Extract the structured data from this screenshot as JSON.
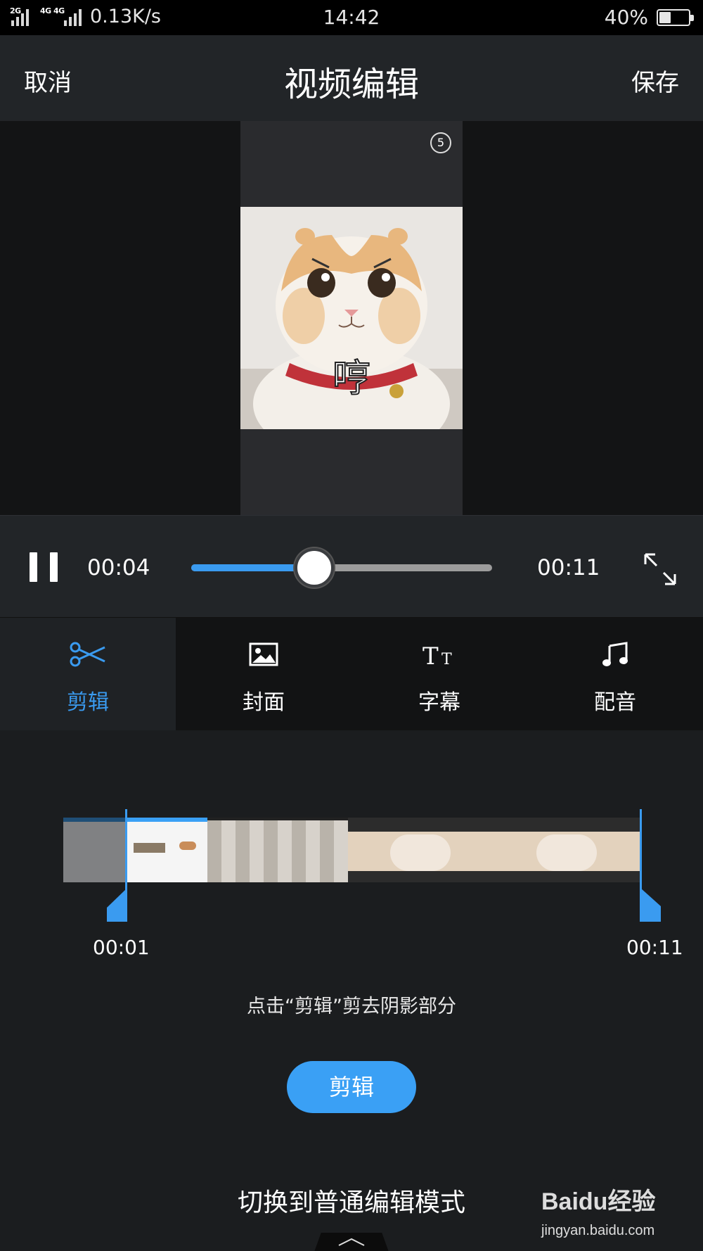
{
  "status_bar": {
    "net_speed": "0.13K/s",
    "time": "14:42",
    "battery_pct": "40%",
    "battery_level": 0.4,
    "signal_1_tag": "2G",
    "signal_2_tag": "4G 4G"
  },
  "header": {
    "cancel_label": "取消",
    "title": "视频编辑",
    "save_label": "保存"
  },
  "preview": {
    "page_counter": "5",
    "caption": "哼"
  },
  "playback": {
    "current_time": "00:04",
    "total_time": "00:11",
    "progress": 0.41
  },
  "tabs": [
    {
      "label": "剪辑",
      "icon": "scissors-icon",
      "active": true
    },
    {
      "label": "封面",
      "icon": "image-icon",
      "active": false
    },
    {
      "label": "字幕",
      "icon": "text-size-icon",
      "active": false
    },
    {
      "label": "配音",
      "icon": "music-note-icon",
      "active": false
    }
  ],
  "trim": {
    "start_time": "00:01",
    "end_time": "00:11",
    "hint": "点击“剪辑”剪去阴影部分",
    "cut_button_label": "剪辑"
  },
  "footer": {
    "switch_mode_label": "切换到普通编辑模式"
  },
  "watermark": {
    "logo_text": "Baidu经验",
    "url": "jingyan.baidu.com"
  },
  "colors": {
    "accent": "#3a9bf0",
    "background": "#1b1d1f",
    "header": "#222528"
  }
}
